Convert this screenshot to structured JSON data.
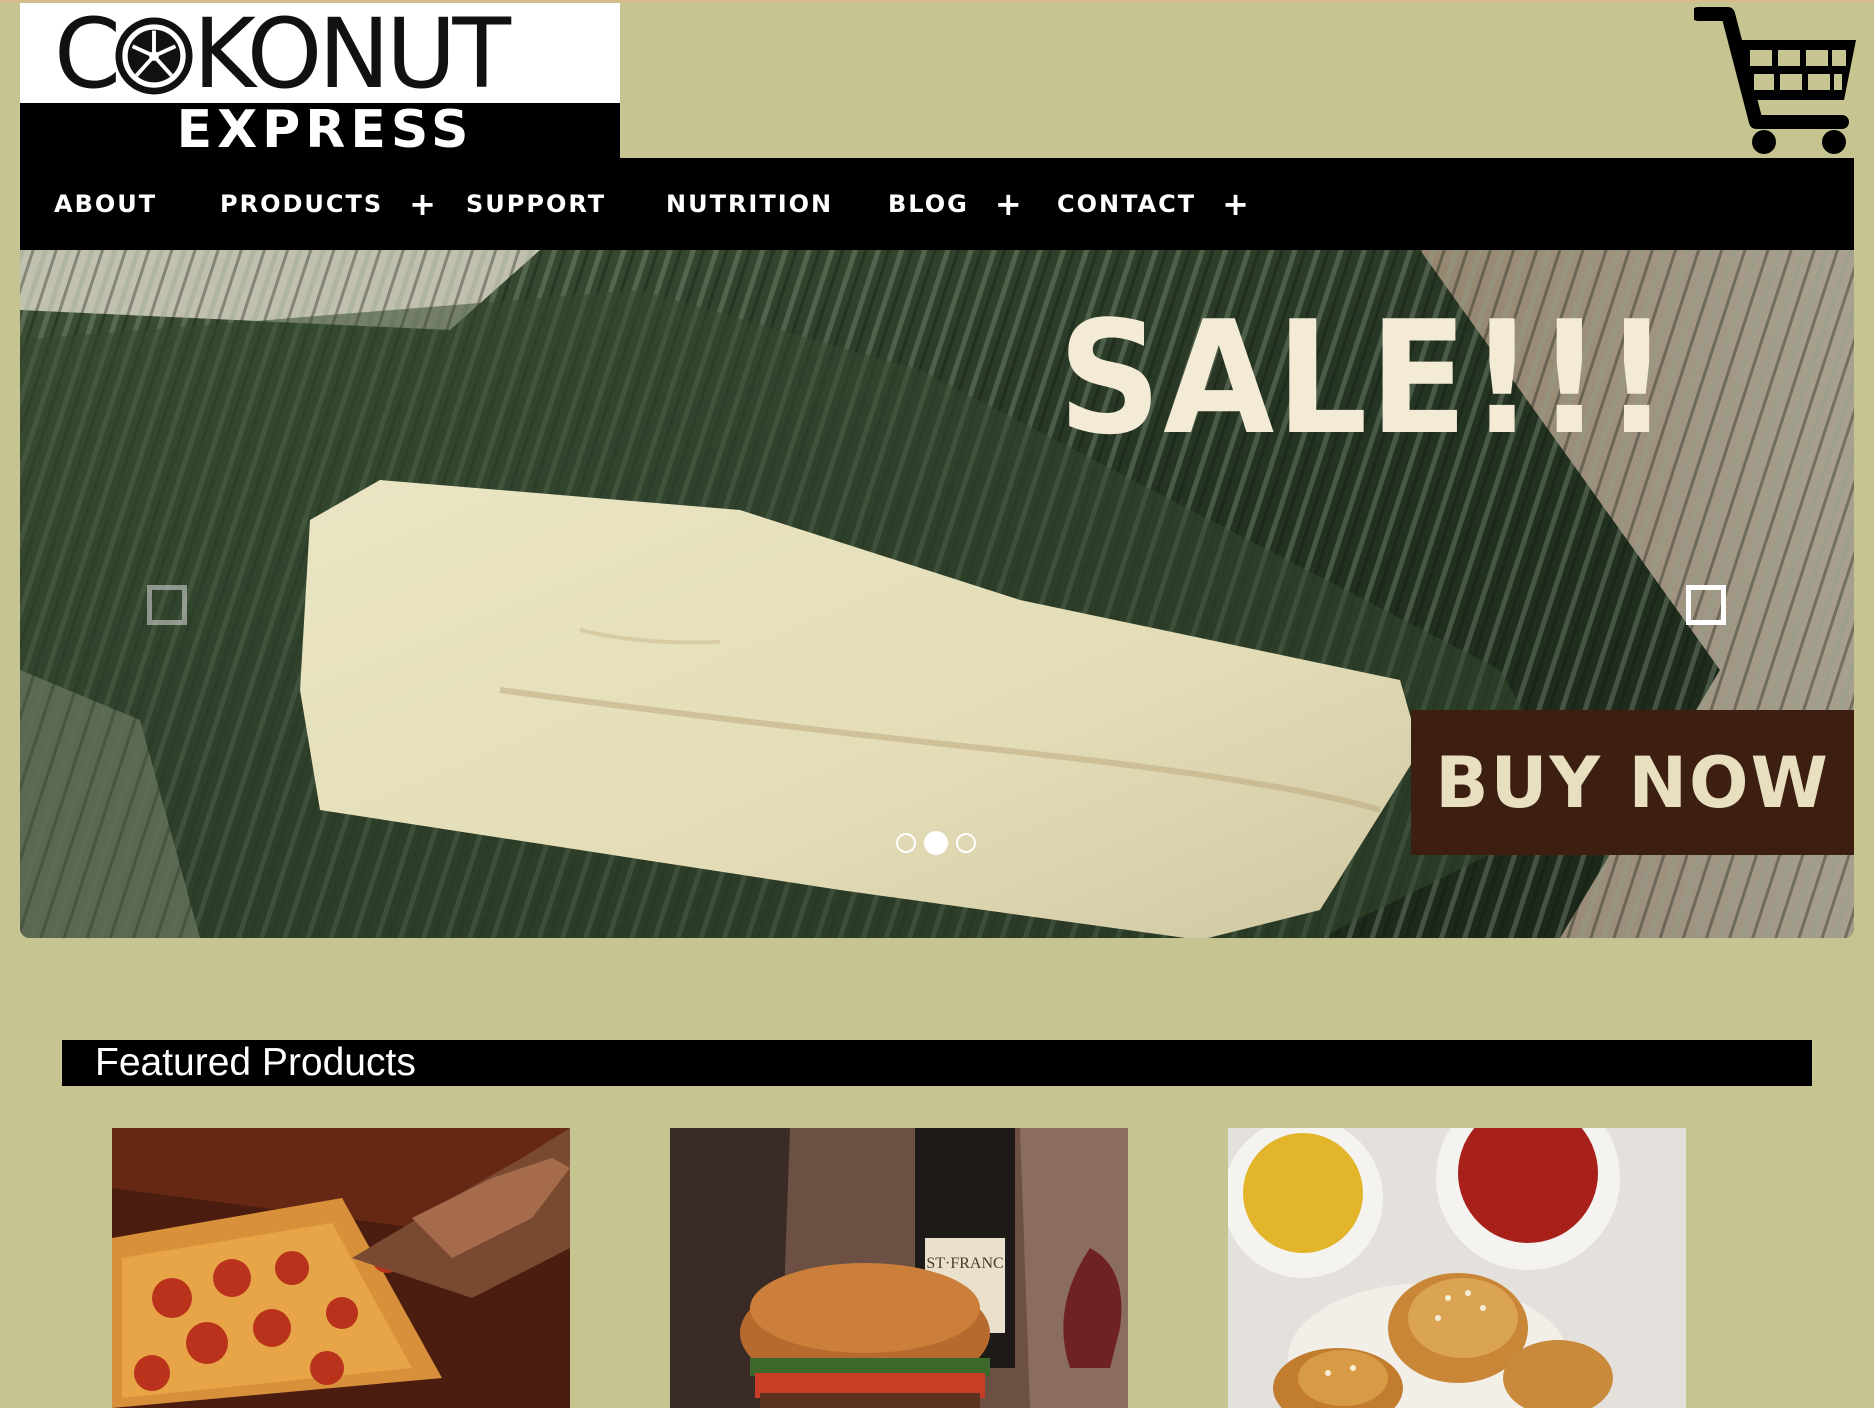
{
  "logo": {
    "brand_word_a": "C",
    "brand_word_b": "KONUT",
    "tagline": "EXPRESS"
  },
  "cart": {
    "icon": "shopping-cart-icon"
  },
  "nav": {
    "items": [
      {
        "label": "ABOUT",
        "has_submenu": false
      },
      {
        "label": "PRODUCTS",
        "has_submenu": true
      },
      {
        "label": "SUPPORT",
        "has_submenu": false
      },
      {
        "label": "NUTRITION",
        "has_submenu": false
      },
      {
        "label": "BLOG",
        "has_submenu": true
      },
      {
        "label": "CONTACT",
        "has_submenu": true
      }
    ],
    "submenu_glyph": "+"
  },
  "hero": {
    "headline": "SALE!!!",
    "cta_label": "BUY NOW",
    "slides_total": 3,
    "active_slide": 2
  },
  "featured": {
    "heading": "Featured Products",
    "products": [
      {
        "image": "pepperoni-pizza"
      },
      {
        "image": "burger-and-wine"
      },
      {
        "image": "pretzel-bites-with-dips"
      }
    ]
  },
  "colors": {
    "page_background": "#c6c591",
    "nav_background": "#000000",
    "cta_background": "#3d1f12",
    "sale_text": "#f3ebd6"
  }
}
